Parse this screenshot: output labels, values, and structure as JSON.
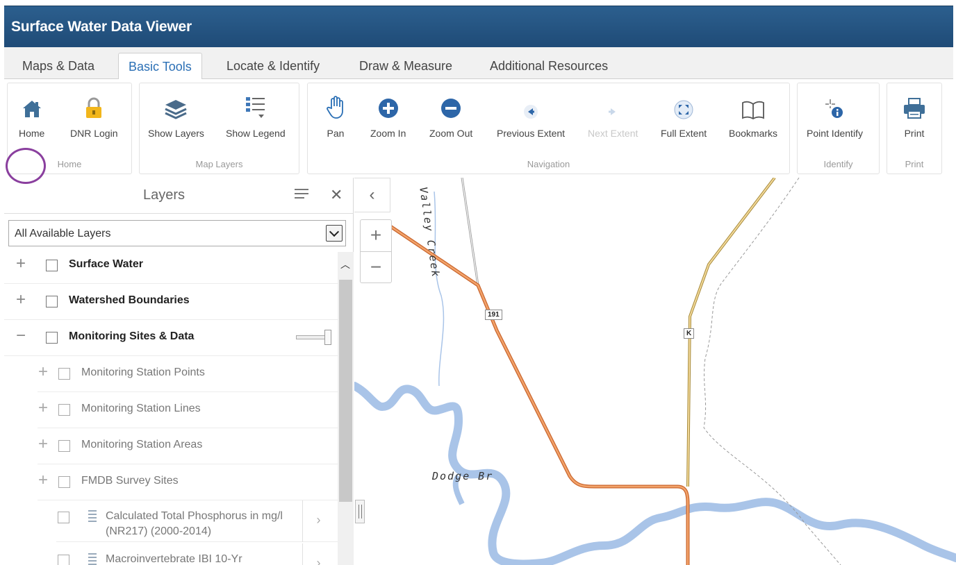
{
  "app": {
    "title": "Surface Water Data Viewer"
  },
  "tabs": [
    {
      "label": "Maps & Data"
    },
    {
      "label": "Basic Tools"
    },
    {
      "label": "Locate & Identify"
    },
    {
      "label": "Draw & Measure"
    },
    {
      "label": "Additional Resources"
    }
  ],
  "active_tab": "Basic Tools",
  "ribbon": {
    "groups": [
      {
        "label": "Home",
        "tools": [
          "Home",
          "DNR Login"
        ]
      },
      {
        "label": "Map Layers",
        "tools": [
          "Show Layers",
          "Show Legend"
        ]
      },
      {
        "label": "Navigation",
        "tools": [
          "Pan",
          "Zoom In",
          "Zoom Out",
          "Previous Extent",
          "Next Extent",
          "Full Extent",
          "Bookmarks"
        ]
      },
      {
        "label": "Identify",
        "tools": [
          "Point Identify"
        ]
      },
      {
        "label": "Print",
        "tools": [
          "Print"
        ]
      }
    ],
    "disabled_tools": [
      "Next Extent"
    ]
  },
  "layers_panel": {
    "title": "Layers",
    "dropdown_value": "All Available Layers",
    "tree": [
      {
        "label": "Surface Water",
        "level": 0,
        "toggle": "+"
      },
      {
        "label": "Watershed Boundaries",
        "level": 0,
        "toggle": "+"
      },
      {
        "label": "Monitoring Sites & Data",
        "level": 0,
        "toggle": "−",
        "opacity": 1.0
      },
      {
        "label": "Monitoring Station Points",
        "level": 1,
        "toggle": "+"
      },
      {
        "label": "Monitoring Station Lines",
        "level": 1,
        "toggle": "+"
      },
      {
        "label": "Monitoring Station Areas",
        "level": 1,
        "toggle": "+"
      },
      {
        "label": "FMDB Survey Sites",
        "level": 1,
        "toggle": "+"
      },
      {
        "label_line1": "Calculated Total Phosphorus in mg/l",
        "label_line2": "(NR217) (2000-2014)",
        "level": 2
      },
      {
        "label_line1": "Macroinvertebrate IBI 10-Yr",
        "level": 2
      }
    ]
  },
  "map": {
    "labels": {
      "creek": "Valley Creek",
      "bridge": "Dodge Br",
      "route_191": "191",
      "route_k": "K"
    },
    "zoom_in": "+",
    "zoom_out": "−",
    "collapse": "‹"
  },
  "colors": {
    "titlebar": "#1f4b77",
    "accent": "#2a6fb5",
    "highlight": "#8a3f9e",
    "road": "#e8894a",
    "water": "#a9c4e8"
  },
  "icons": [
    "home-icon",
    "lock-icon",
    "layers-icon",
    "legend-icon",
    "hand-icon",
    "zoom-in-icon",
    "zoom-out-icon",
    "arrow-left-icon",
    "arrow-right-icon",
    "full-extent-icon",
    "book-icon",
    "point-identify-icon",
    "printer-icon"
  ]
}
